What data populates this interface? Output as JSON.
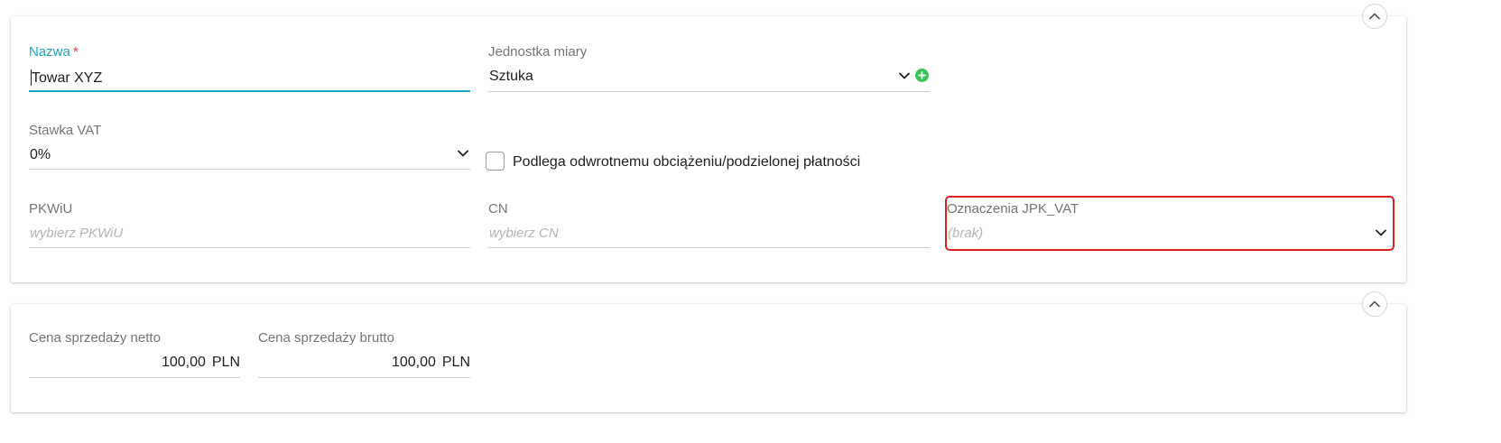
{
  "section_main": {
    "name": {
      "label": "Nazwa",
      "required_mark": "*",
      "value": "Towar XYZ"
    },
    "unit": {
      "label": "Jednostka miary",
      "value": "Sztuka"
    },
    "vat_rate": {
      "label": "Stawka VAT",
      "value": "0%"
    },
    "reverse_charge": {
      "label": "Podlega odwrotnemu obciążeniu/podzielonej płatności",
      "checked": false
    },
    "pkwiu": {
      "label": "PKWiU",
      "placeholder": "wybierz PKWiU"
    },
    "cn": {
      "label": "CN",
      "placeholder": "wybierz CN"
    },
    "jpk_vat": {
      "label": "Oznaczenia JPK_VAT",
      "value": "(brak)"
    }
  },
  "section_price": {
    "net": {
      "label": "Cena sprzedaży netto",
      "value": "100,00",
      "currency": "PLN"
    },
    "gross": {
      "label": "Cena sprzedaży brutto",
      "value": "100,00",
      "currency": "PLN"
    }
  },
  "colors": {
    "accent": "#19a7c4",
    "required": "#e53935",
    "add": "#3cc35a",
    "highlight": "#e0201f"
  }
}
